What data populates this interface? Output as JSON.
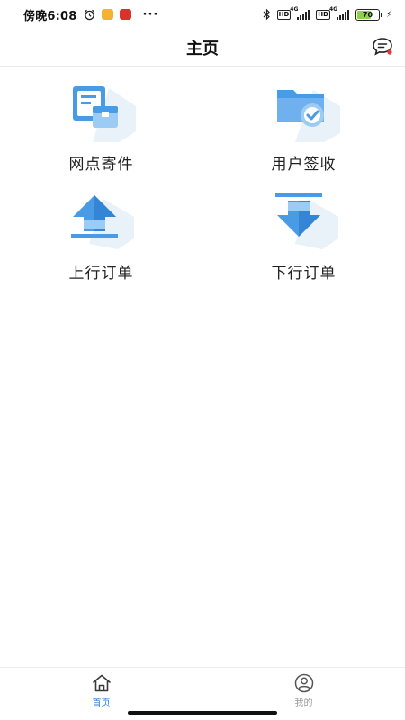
{
  "status_bar": {
    "time": "傍晚6:08",
    "battery_level": 70,
    "battery_text": "70",
    "network": "4G",
    "hd": "HD",
    "more": "···"
  },
  "header": {
    "title": "主页"
  },
  "menu": {
    "items": [
      {
        "label": "网点寄件",
        "icon": "outlet-send-icon"
      },
      {
        "label": "用户签收",
        "icon": "user-sign-icon"
      },
      {
        "label": "上行订单",
        "icon": "upload-order-icon"
      },
      {
        "label": "下行订单",
        "icon": "download-order-icon"
      }
    ]
  },
  "bottom_nav": {
    "home_label": "首页",
    "mine_label": "我的"
  },
  "colors": {
    "accent": "#2f7ed8",
    "icon_blue": "#4a9be6",
    "icon_light": "#9ccbf3",
    "icon_shadow": "#e9f1f9",
    "inactive": "#9a9a9a",
    "battery": "#8bd34a"
  }
}
